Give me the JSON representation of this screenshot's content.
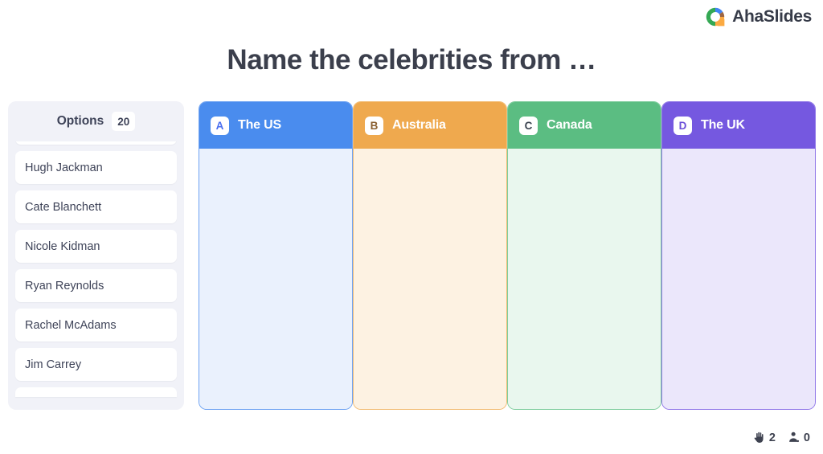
{
  "brand": {
    "name": "AhaSlides",
    "logo_icon": "ahaslides-donut-logo",
    "colors": {
      "blue": "#4285f4",
      "green": "#34a853",
      "orange": "#fbaa42",
      "purple": "#8e5ea8",
      "brown": "#9c6644"
    }
  },
  "title": "Name the celebrities from …",
  "options": {
    "label": "Options",
    "count": "20",
    "items": [
      {
        "label": "Hugh Jackman"
      },
      {
        "label": "Cate Blanchett"
      },
      {
        "label": "Nicole Kidman"
      },
      {
        "label": "Ryan Reynolds"
      },
      {
        "label": "Rachel McAdams"
      },
      {
        "label": "Jim Carrey"
      }
    ]
  },
  "columns": [
    {
      "key": "A",
      "label": "The US",
      "header_color": "#4a8cee",
      "body_color": "#eaf1fd",
      "border_color": "#6fa3f2",
      "letter_color": "#4a6ff0"
    },
    {
      "key": "B",
      "label": "Australia",
      "header_color": "#efa94e",
      "body_color": "#fdf2e2",
      "border_color": "#f3bd74",
      "letter_color": "#8a6032"
    },
    {
      "key": "C",
      "label": "Canada",
      "header_color": "#5bbd82",
      "body_color": "#e9f7ee",
      "border_color": "#7fcd9d",
      "letter_color": "#3b4450"
    },
    {
      "key": "D",
      "label": "The UK",
      "header_color": "#7558e0",
      "body_color": "#ebe7fb",
      "border_color": "#9279e8",
      "letter_color": "#6b4fd8"
    }
  ],
  "status": {
    "hands_raised": "2",
    "participants": "0",
    "hand_icon": "raised-hand-icon",
    "person_icon": "person-icon"
  }
}
